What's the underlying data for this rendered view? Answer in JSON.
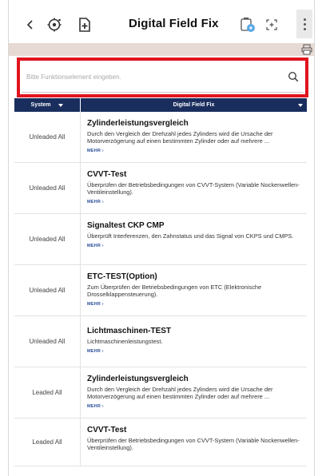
{
  "toolbar": {
    "title": "Digital Field Fix",
    "icons": [
      "back-icon",
      "vci-settings-icon",
      "add-document-icon",
      "battery-status-icon",
      "expand-icon",
      "more-icon"
    ]
  },
  "search": {
    "placeholder": "Bitte Funktionselement eingeben.",
    "value": ""
  },
  "table": {
    "columns": [
      {
        "label": "System"
      },
      {
        "label": "Digital Field Fix"
      }
    ],
    "rows": [
      {
        "system": "Unleaded All",
        "title": "Zylinderleistungsvergleich",
        "description": "Durch den Vergleich der Drehzahl jedes Zylinders wird die Ursache der Motorverzögerung auf einen bestimmten Zylinder oder auf mehrere ...",
        "more": "MEHR ›"
      },
      {
        "system": "Unleaded All",
        "title": "CVVT-Test",
        "description": "Überprüfen der Betriebsbedingungen von CVVT-System (Variable Nockenwellen-Ventileinstellung).",
        "more": "MEHR ›"
      },
      {
        "system": "Unleaded All",
        "title": "Signaltest CKP CMP",
        "description": "Überprüft Interferenzen, den Zahnstatus und das Signal von CKPS und CMPS.",
        "more": "MEHR ›"
      },
      {
        "system": "Unleaded All",
        "title": "ETC-TEST(Option)",
        "description": "Zum Überprüfen der Betriebsbedingungen von ETC (Elektronische Drosselklappensteuerung).",
        "more": "MEHR ›"
      },
      {
        "system": "Unleaded All",
        "title": "Lichtmaschinen-TEST",
        "description": "Lichtmaschinenleistungstest.",
        "more": "MEHR ›"
      },
      {
        "system": "Leaded All",
        "title": "Zylinderleistungsvergleich",
        "description": "Durch den Vergleich der Drehzahl jedes Zylinders wird die Ursache der Motorverzögerung auf einen bestimmten Zylinder oder auf mehrere ...",
        "more": "MEHR ›"
      },
      {
        "system": "Leaded All",
        "title": "CVVT-Test",
        "description": "Überprüfen der Betriebsbedingungen von CVVT-System (Variable Nockenwellen-Ventileinstellung).",
        "more": ""
      }
    ]
  },
  "colors": {
    "header_bg": "#1a2e5e",
    "highlight_box": "#e0141e",
    "band": "#e7d9d4",
    "more_link": "#2a4f9a"
  }
}
